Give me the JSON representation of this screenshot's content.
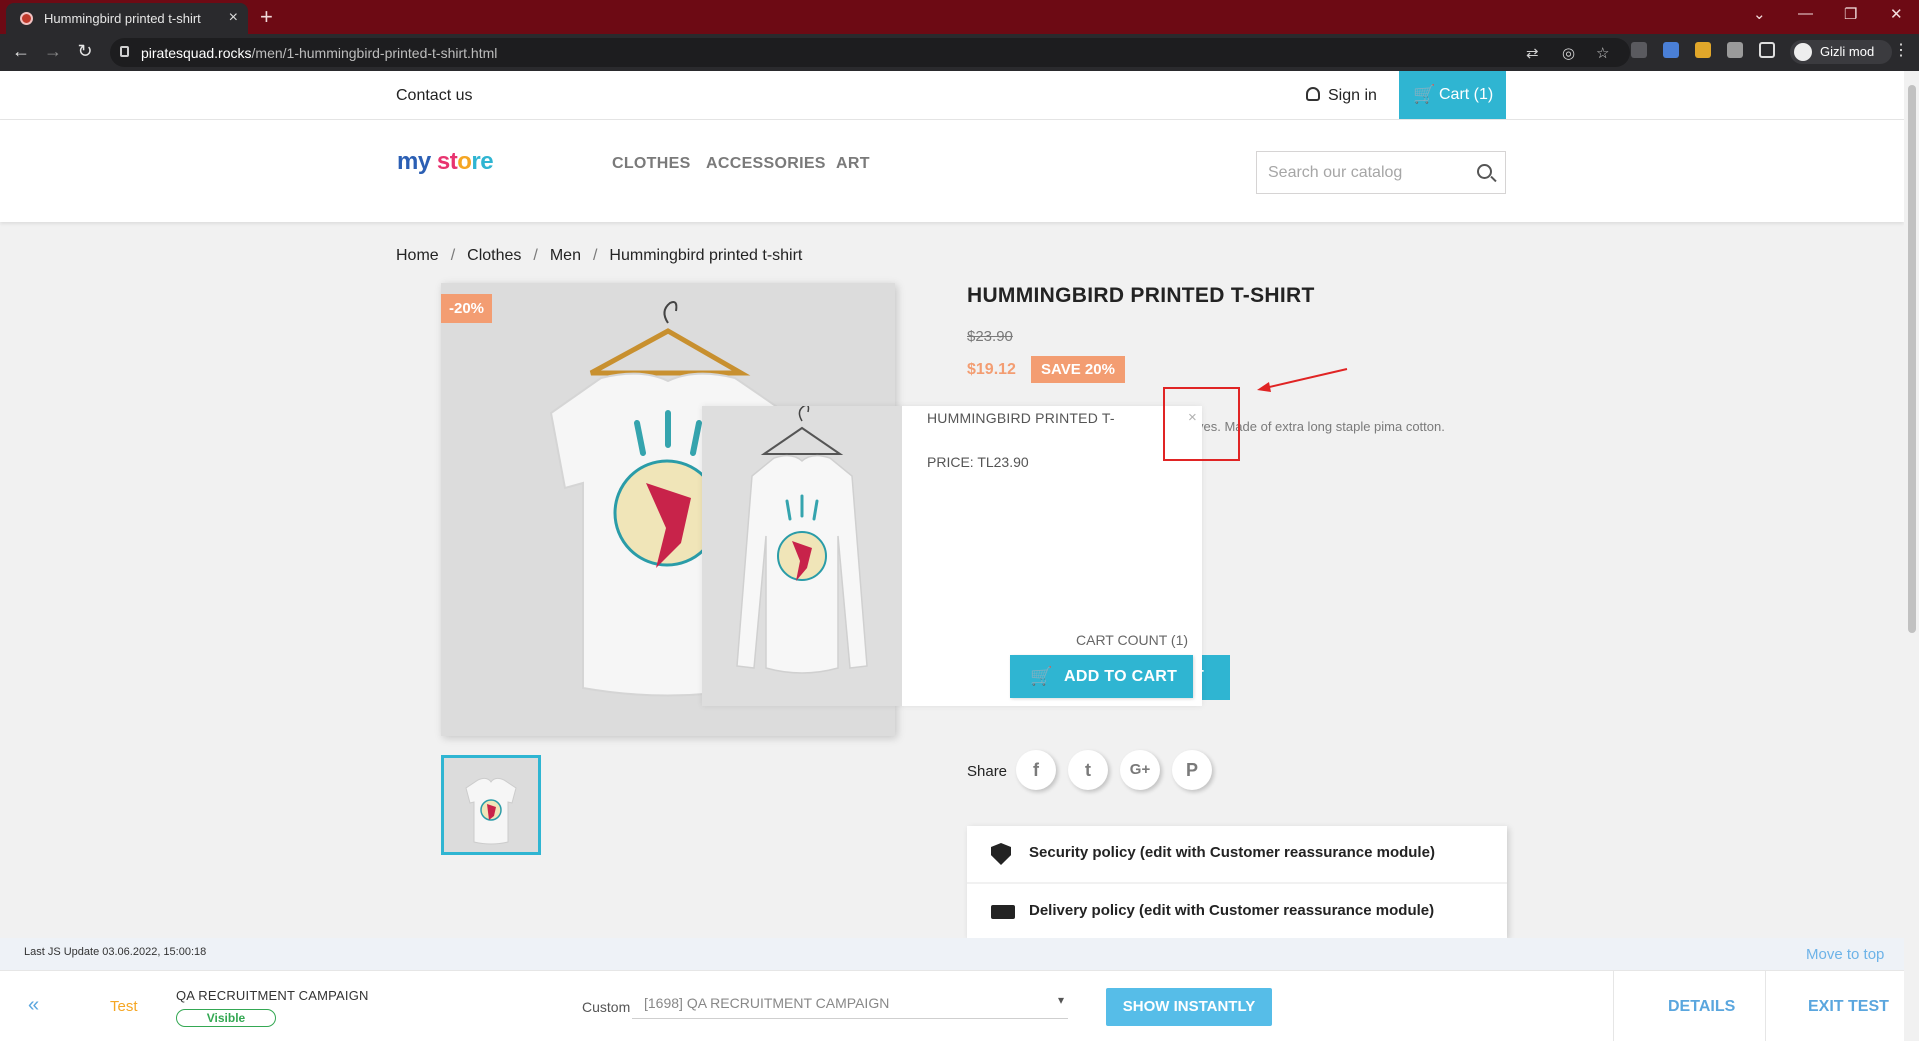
{
  "browser": {
    "tab_title": "Hummingbird printed t-shirt",
    "tab_close": "×",
    "new_tab": "+",
    "url_host": "piratesquad.rocks",
    "url_path": "/men/1-hummingbird-printed-t-shirt.html",
    "profile_label": "Gizli mod",
    "nav_back": "←",
    "nav_forward": "→",
    "nav_reload": "↻",
    "win_minimize": "—",
    "win_restore": "❐",
    "win_close": "✕",
    "tab_dropdown": "⌄",
    "kebab": "⋮"
  },
  "store": {
    "contact": "Contact us",
    "signin": "Sign in",
    "cart": "Cart (1)",
    "cart_icon": "🛒",
    "logo": {
      "p1": "my",
      "p2": " st",
      "p3": "o",
      "p4": "re"
    },
    "menu": [
      "CLOTHES",
      "ACCESSORIES",
      "ART"
    ],
    "search_placeholder": "Search our catalog"
  },
  "breadcrumb": [
    "Home",
    "Clothes",
    "Men",
    "Hummingbird printed t-shirt"
  ],
  "breadcrumb_sep": "/",
  "product": {
    "discount_badge": "-20%",
    "title": "HUMMINGBIRD PRINTED T-SHIRT",
    "old_price": "$23.90",
    "price": "$19.12",
    "save_badge": "SAVE 20%",
    "description_fragment": "ves. Made of extra long staple pima cotton.",
    "add_cart_fragment": "T",
    "share_label": "Share",
    "share_buttons": [
      "f",
      "t",
      "G+",
      "P"
    ]
  },
  "popup": {
    "title": "HUMMINGBIRD PRINTED T-",
    "price": "PRICE: TL23.90",
    "close": "×",
    "cart_count": "CART COUNT (1)",
    "add_to_cart": "ADD TO CART"
  },
  "reassurance": [
    {
      "text": "Security policy (edit with Customer reassurance module)",
      "icon": "shield-icon"
    },
    {
      "text": "Delivery policy (edit with Customer reassurance module)",
      "icon": "truck-icon"
    }
  ],
  "toolbar": {
    "last_js": "Last JS Update 03.06.2022, 15:00:18",
    "move_to_top": "Move to top",
    "collapse": "«",
    "test_label": "Test",
    "campaign": "QA RECRUITMENT CAMPAIGN",
    "visible_badge": "Visible",
    "custom_label": "Custom",
    "select_value": "[1698] QA RECRUITMENT CAMPAIGN",
    "show_instantly": "SHOW INSTANTLY",
    "details": "DETAILS",
    "exit_test": "EXIT TEST"
  },
  "colors": {
    "accent": "#2fb5d2",
    "discount": "#f39d72",
    "tab_strip": "#6d0a14",
    "annotation": "#e02424"
  }
}
